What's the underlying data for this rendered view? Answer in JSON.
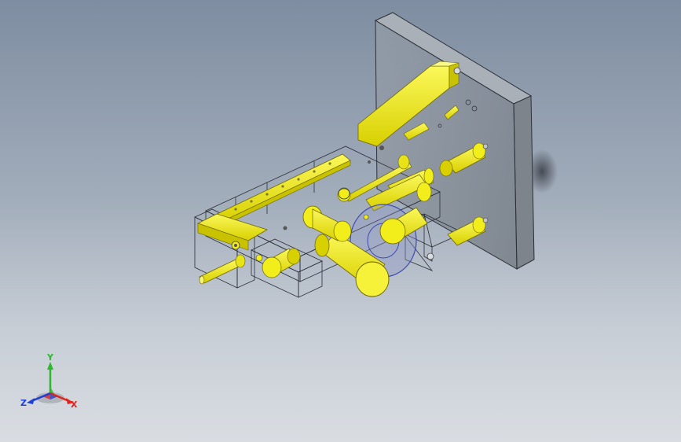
{
  "viewport": {
    "background_top": "#7e8da1",
    "background_bottom": "#d9dde2"
  },
  "model": {
    "part_color": "#f2ee1c",
    "part_shadow": "#c9c200",
    "frame_color": "#2b2f36",
    "plate_color": "#8f969e",
    "ring_color": "#5a67c8"
  },
  "triad": {
    "x_label": "X",
    "y_label": "Y",
    "z_label": "Z",
    "x_color": "#e0231c",
    "y_color": "#2db82d",
    "z_color": "#1f3fd6"
  }
}
